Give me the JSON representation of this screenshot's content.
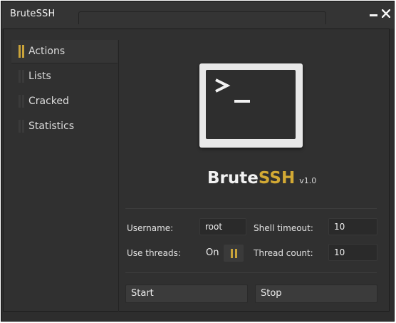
{
  "window": {
    "title": "BruteSSH",
    "minimize_icon": "minimize-icon",
    "close_icon": "close-icon"
  },
  "sidebar": {
    "items": [
      {
        "label": "Actions",
        "active": true
      },
      {
        "label": "Lists",
        "active": false
      },
      {
        "label": "Cracked",
        "active": false
      },
      {
        "label": "Statistics",
        "active": false
      }
    ]
  },
  "logo": {
    "icon": "terminal-prompt-icon",
    "glyph": ">_"
  },
  "brand": {
    "name_main": "Brute",
    "name_accent": "SSH",
    "version": "v1.0"
  },
  "form": {
    "username_label": "Username:",
    "username_value": "root",
    "shell_timeout_label": "Shell timeout:",
    "shell_timeout_value": "10",
    "use_threads_label": "Use threads:",
    "use_threads_value": "On",
    "thread_count_label": "Thread count:",
    "thread_count_value": "10"
  },
  "actions": {
    "start_label": "Start",
    "stop_label": "Stop"
  },
  "colors": {
    "accent": "#c9a33a",
    "background": "#2d2d2d",
    "text": "#e6e6e6"
  }
}
